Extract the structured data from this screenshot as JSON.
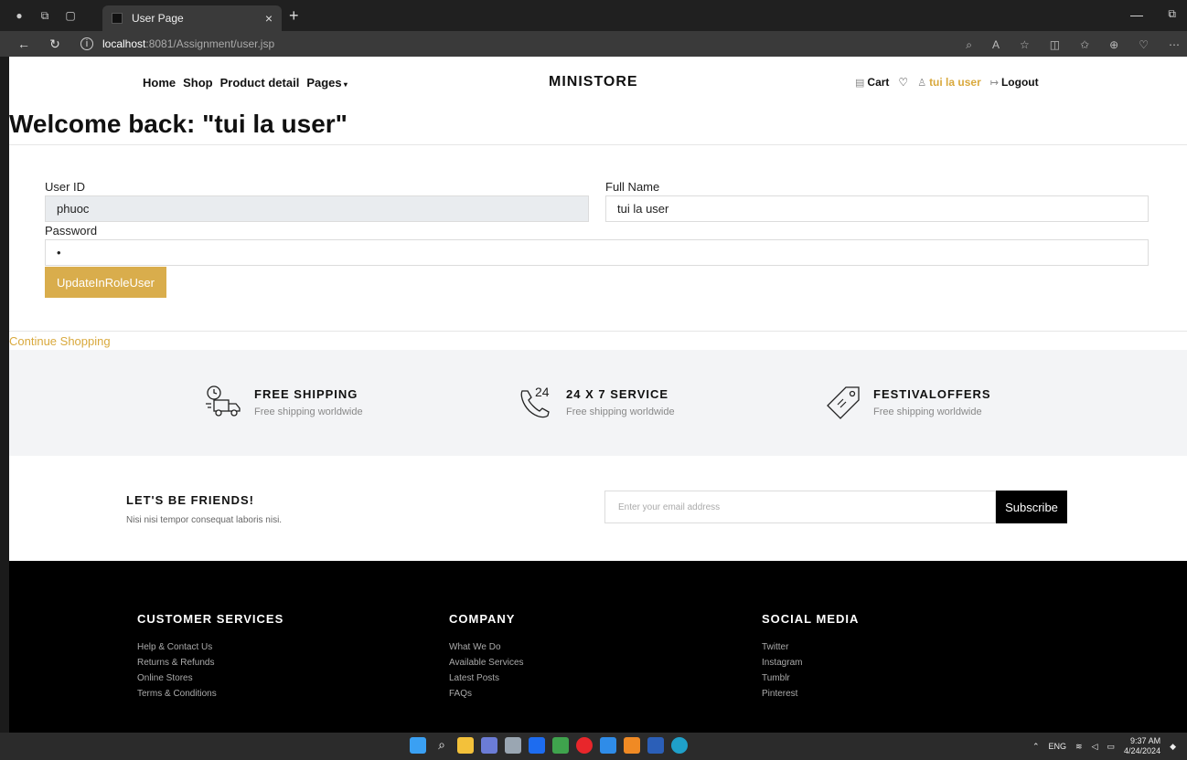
{
  "browser": {
    "tab_title": "User Page",
    "tab_close": "×",
    "new_tab": "+",
    "url_host": "localhost",
    "url_path": ":8081/Assignment/user.jsp"
  },
  "nav": {
    "links": [
      "Home",
      "Shop",
      "Product detail",
      "Pages"
    ],
    "brand": "MINISTORE",
    "cart": "Cart",
    "user": "tui la user",
    "logout": "Logout"
  },
  "welcome": "Welcome back: \"tui la user\"",
  "form": {
    "user_id_label": "User ID",
    "user_id_value": "phuoc",
    "full_name_label": "Full Name",
    "full_name_value": "tui la user",
    "password_label": "Password",
    "password_value": "•",
    "update_button": "UpdateInRoleUser"
  },
  "continue_link": "Continue Shopping",
  "features": [
    {
      "title": "FREE SHIPPING",
      "subtitle": "Free shipping worldwide",
      "icon": "truck-icon"
    },
    {
      "title": "24 X 7 SERVICE",
      "subtitle": "Free shipping worldwide",
      "icon": "phone-24-icon"
    },
    {
      "title": "FESTIVALOFFERS",
      "subtitle": "Free shipping worldwide",
      "icon": "tag-icon"
    }
  ],
  "newsletter": {
    "title": "LET'S BE FRIENDS!",
    "subtitle": "Nisi nisi tempor consequat laboris nisi.",
    "placeholder": "Enter your email address",
    "button": "Subscribe"
  },
  "footer": {
    "columns": [
      {
        "title": "CUSTOMER SERVICES",
        "links": [
          "Help & Contact Us",
          "Returns & Refunds",
          "Online Stores",
          "Terms & Conditions"
        ]
      },
      {
        "title": "COMPANY",
        "links": [
          "What We Do",
          "Available Services",
          "Latest Posts",
          "FAQs"
        ]
      },
      {
        "title": "SOCIAL MEDIA",
        "links": [
          "Twitter",
          "Instagram",
          "Tumblr",
          "Pinterest"
        ]
      }
    ]
  },
  "taskbar": {
    "lang": "ENG",
    "time": "9:37 AM",
    "date": "4/24/2024"
  }
}
